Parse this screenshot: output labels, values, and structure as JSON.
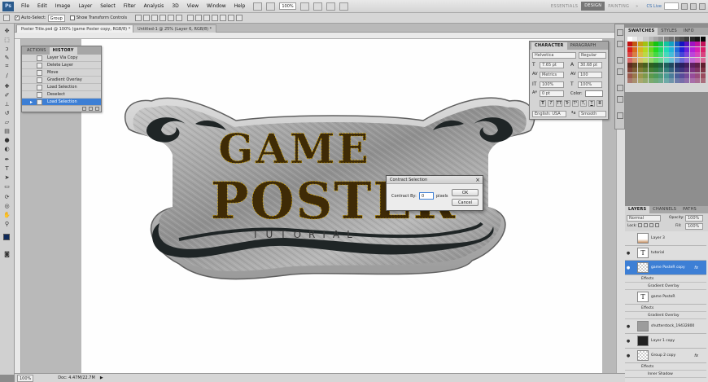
{
  "app": {
    "logo": "Ps"
  },
  "menubar": {
    "items": [
      "File",
      "Edit",
      "Image",
      "Layer",
      "Select",
      "Filter",
      "Analysis",
      "3D",
      "View",
      "Window",
      "Help"
    ],
    "zoom": "100%",
    "workspaces": [
      "ESSENTIALS",
      "DESIGN",
      "PAINTING"
    ],
    "active_workspace": "DESIGN",
    "more": "»",
    "cs_live": "CS Live"
  },
  "options": {
    "auto_select_label": "Auto-Select:",
    "auto_select_value": "Group",
    "transform_label": "Show Transform Controls"
  },
  "tabs": [
    {
      "label": "Poster Title.psd @ 100% (game Poster copy, RGB/8) *",
      "active": true
    },
    {
      "label": "Untitled-1 @ 25% (Layer 6, RGB/8) *",
      "active": false
    }
  ],
  "history_panel": {
    "tabs": [
      "ACTIONS",
      "HISTORY"
    ],
    "active_tab": "HISTORY",
    "items": [
      "Layer Via Copy",
      "Delete Layer",
      "Move",
      "Gradient Overlay",
      "Load Selection",
      "Deselect",
      "Load Selection"
    ],
    "selected_index": 6
  },
  "character_panel": {
    "tabs": [
      "CHARACTER",
      "PARAGRAPH"
    ],
    "font_family": "Helvetica",
    "font_style": "Regular",
    "font_size": "7.65 pt",
    "leading": "30.68 pt",
    "kerning": "Metrics",
    "tracking": "100",
    "vscale": "100%",
    "hscale": "100%",
    "baseline": "0 pt",
    "color_label": "Color:",
    "style_buttons": [
      "T",
      "T",
      "TT",
      "Tr",
      "T¹",
      "T,",
      "T",
      "T"
    ],
    "language": "English: USA",
    "antialias": "Smooth"
  },
  "dialog": {
    "title": "Contract Selection",
    "label": "Contract By:",
    "value": "0",
    "unit": "pixels",
    "ok": "OK",
    "cancel": "Cancel"
  },
  "artwork": {
    "line1": "GAME",
    "line2": "POSTER",
    "line3": "TUTORIAL"
  },
  "swatches_panel": {
    "tabs": [
      "SWATCHES",
      "STYLES",
      "INFO"
    ]
  },
  "layers_panel": {
    "tabs": [
      "LAYERS",
      "CHANNELS",
      "PATHS"
    ],
    "blend_mode": "Normal",
    "opacity_label": "Opacity:",
    "opacity": "100%",
    "lock_label": "Lock:",
    "fill_label": "Fill:",
    "fill": "100%",
    "layers": [
      {
        "name": "Layer 3",
        "thumb": "",
        "visible": false,
        "fx": "",
        "selected": false
      },
      {
        "name": "tutorial",
        "thumb": "T",
        "visible": true,
        "fx": "",
        "selected": false
      },
      {
        "name": "game PosteR copy",
        "thumb": "",
        "visible": true,
        "fx": "fx",
        "selected": true
      },
      {
        "name": "game PosteR",
        "thumb": "T",
        "visible": false,
        "fx": "",
        "selected": false
      },
      {
        "name": "shutterstock_19432800",
        "thumb": "",
        "visible": true,
        "fx": "",
        "selected": false
      },
      {
        "name": "Layer 1 copy",
        "thumb": "",
        "visible": true,
        "fx": "",
        "selected": false
      },
      {
        "name": "Group 2 copy",
        "thumb": "",
        "visible": true,
        "fx": "fx",
        "selected": false
      }
    ],
    "effects_label": "Effects",
    "effect_gradient": "Gradient Overlay",
    "effect_inner_shadow": "Inner Shadow"
  },
  "status": {
    "zoom": "100%",
    "doc": "Doc: 4.47M/22.7M"
  },
  "colors": {
    "selection_blue": "#3d7fd5",
    "title_text": "#3f2b06",
    "metal": "#a9a9a9"
  }
}
